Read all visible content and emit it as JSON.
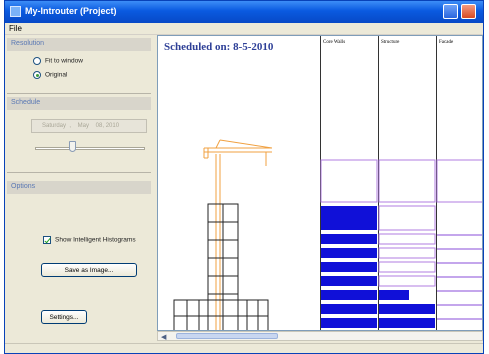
{
  "window": {
    "title": "My-Introuter (Project)"
  },
  "menu": {
    "file": "File"
  },
  "resolution": {
    "heading": "Resolution",
    "fit_label": "Fit to window",
    "original_label": "Original",
    "selected": "Original"
  },
  "schedule": {
    "heading": "Schedule",
    "date_field": "Saturday  ,    May    08, 2010",
    "slider_position": 0.33
  },
  "options": {
    "heading": "Options",
    "show_histograms_label": "Show Intelligent Histograms",
    "show_histograms_checked": true,
    "save_image_label": "Save as Image...",
    "settings_label": "Settings..."
  },
  "view": {
    "scheduled_on": "Scheduled on: 8-5-2010",
    "columns": [
      "Core Walls",
      "Structure",
      "Facade"
    ]
  },
  "colors": {
    "histogram_fill": "#1010d8",
    "histogram_border": "#b27ee0",
    "crane": "#f0a040",
    "scaffold": "#222222",
    "title_text": "#2d3f97"
  },
  "icons": {
    "scroll_left": "scroll-left-arrow-icon",
    "scroll_right": "scroll-right-arrow-icon"
  }
}
